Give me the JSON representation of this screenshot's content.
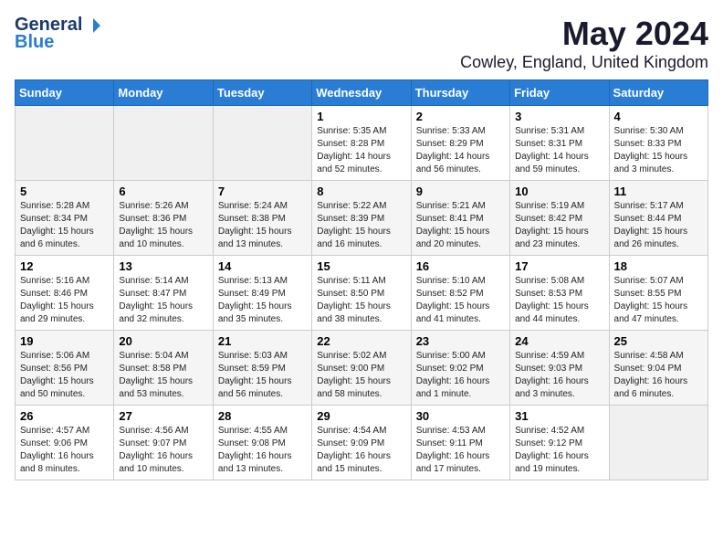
{
  "logo": {
    "general": "General",
    "blue": "Blue"
  },
  "title": "May 2024",
  "location": "Cowley, England, United Kingdom",
  "weekdays": [
    "Sunday",
    "Monday",
    "Tuesday",
    "Wednesday",
    "Thursday",
    "Friday",
    "Saturday"
  ],
  "weeks": [
    [
      {
        "day": "",
        "sunrise": "",
        "sunset": "",
        "daylight": ""
      },
      {
        "day": "",
        "sunrise": "",
        "sunset": "",
        "daylight": ""
      },
      {
        "day": "",
        "sunrise": "",
        "sunset": "",
        "daylight": ""
      },
      {
        "day": "1",
        "sunrise": "Sunrise: 5:35 AM",
        "sunset": "Sunset: 8:28 PM",
        "daylight": "Daylight: 14 hours and 52 minutes."
      },
      {
        "day": "2",
        "sunrise": "Sunrise: 5:33 AM",
        "sunset": "Sunset: 8:29 PM",
        "daylight": "Daylight: 14 hours and 56 minutes."
      },
      {
        "day": "3",
        "sunrise": "Sunrise: 5:31 AM",
        "sunset": "Sunset: 8:31 PM",
        "daylight": "Daylight: 14 hours and 59 minutes."
      },
      {
        "day": "4",
        "sunrise": "Sunrise: 5:30 AM",
        "sunset": "Sunset: 8:33 PM",
        "daylight": "Daylight: 15 hours and 3 minutes."
      }
    ],
    [
      {
        "day": "5",
        "sunrise": "Sunrise: 5:28 AM",
        "sunset": "Sunset: 8:34 PM",
        "daylight": "Daylight: 15 hours and 6 minutes."
      },
      {
        "day": "6",
        "sunrise": "Sunrise: 5:26 AM",
        "sunset": "Sunset: 8:36 PM",
        "daylight": "Daylight: 15 hours and 10 minutes."
      },
      {
        "day": "7",
        "sunrise": "Sunrise: 5:24 AM",
        "sunset": "Sunset: 8:38 PM",
        "daylight": "Daylight: 15 hours and 13 minutes."
      },
      {
        "day": "8",
        "sunrise": "Sunrise: 5:22 AM",
        "sunset": "Sunset: 8:39 PM",
        "daylight": "Daylight: 15 hours and 16 minutes."
      },
      {
        "day": "9",
        "sunrise": "Sunrise: 5:21 AM",
        "sunset": "Sunset: 8:41 PM",
        "daylight": "Daylight: 15 hours and 20 minutes."
      },
      {
        "day": "10",
        "sunrise": "Sunrise: 5:19 AM",
        "sunset": "Sunset: 8:42 PM",
        "daylight": "Daylight: 15 hours and 23 minutes."
      },
      {
        "day": "11",
        "sunrise": "Sunrise: 5:17 AM",
        "sunset": "Sunset: 8:44 PM",
        "daylight": "Daylight: 15 hours and 26 minutes."
      }
    ],
    [
      {
        "day": "12",
        "sunrise": "Sunrise: 5:16 AM",
        "sunset": "Sunset: 8:46 PM",
        "daylight": "Daylight: 15 hours and 29 minutes."
      },
      {
        "day": "13",
        "sunrise": "Sunrise: 5:14 AM",
        "sunset": "Sunset: 8:47 PM",
        "daylight": "Daylight: 15 hours and 32 minutes."
      },
      {
        "day": "14",
        "sunrise": "Sunrise: 5:13 AM",
        "sunset": "Sunset: 8:49 PM",
        "daylight": "Daylight: 15 hours and 35 minutes."
      },
      {
        "day": "15",
        "sunrise": "Sunrise: 5:11 AM",
        "sunset": "Sunset: 8:50 PM",
        "daylight": "Daylight: 15 hours and 38 minutes."
      },
      {
        "day": "16",
        "sunrise": "Sunrise: 5:10 AM",
        "sunset": "Sunset: 8:52 PM",
        "daylight": "Daylight: 15 hours and 41 minutes."
      },
      {
        "day": "17",
        "sunrise": "Sunrise: 5:08 AM",
        "sunset": "Sunset: 8:53 PM",
        "daylight": "Daylight: 15 hours and 44 minutes."
      },
      {
        "day": "18",
        "sunrise": "Sunrise: 5:07 AM",
        "sunset": "Sunset: 8:55 PM",
        "daylight": "Daylight: 15 hours and 47 minutes."
      }
    ],
    [
      {
        "day": "19",
        "sunrise": "Sunrise: 5:06 AM",
        "sunset": "Sunset: 8:56 PM",
        "daylight": "Daylight: 15 hours and 50 minutes."
      },
      {
        "day": "20",
        "sunrise": "Sunrise: 5:04 AM",
        "sunset": "Sunset: 8:58 PM",
        "daylight": "Daylight: 15 hours and 53 minutes."
      },
      {
        "day": "21",
        "sunrise": "Sunrise: 5:03 AM",
        "sunset": "Sunset: 8:59 PM",
        "daylight": "Daylight: 15 hours and 56 minutes."
      },
      {
        "day": "22",
        "sunrise": "Sunrise: 5:02 AM",
        "sunset": "Sunset: 9:00 PM",
        "daylight": "Daylight: 15 hours and 58 minutes."
      },
      {
        "day": "23",
        "sunrise": "Sunrise: 5:00 AM",
        "sunset": "Sunset: 9:02 PM",
        "daylight": "Daylight: 16 hours and 1 minute."
      },
      {
        "day": "24",
        "sunrise": "Sunrise: 4:59 AM",
        "sunset": "Sunset: 9:03 PM",
        "daylight": "Daylight: 16 hours and 3 minutes."
      },
      {
        "day": "25",
        "sunrise": "Sunrise: 4:58 AM",
        "sunset": "Sunset: 9:04 PM",
        "daylight": "Daylight: 16 hours and 6 minutes."
      }
    ],
    [
      {
        "day": "26",
        "sunrise": "Sunrise: 4:57 AM",
        "sunset": "Sunset: 9:06 PM",
        "daylight": "Daylight: 16 hours and 8 minutes."
      },
      {
        "day": "27",
        "sunrise": "Sunrise: 4:56 AM",
        "sunset": "Sunset: 9:07 PM",
        "daylight": "Daylight: 16 hours and 10 minutes."
      },
      {
        "day": "28",
        "sunrise": "Sunrise: 4:55 AM",
        "sunset": "Sunset: 9:08 PM",
        "daylight": "Daylight: 16 hours and 13 minutes."
      },
      {
        "day": "29",
        "sunrise": "Sunrise: 4:54 AM",
        "sunset": "Sunset: 9:09 PM",
        "daylight": "Daylight: 16 hours and 15 minutes."
      },
      {
        "day": "30",
        "sunrise": "Sunrise: 4:53 AM",
        "sunset": "Sunset: 9:11 PM",
        "daylight": "Daylight: 16 hours and 17 minutes."
      },
      {
        "day": "31",
        "sunrise": "Sunrise: 4:52 AM",
        "sunset": "Sunset: 9:12 PM",
        "daylight": "Daylight: 16 hours and 19 minutes."
      },
      {
        "day": "",
        "sunrise": "",
        "sunset": "",
        "daylight": ""
      }
    ]
  ]
}
